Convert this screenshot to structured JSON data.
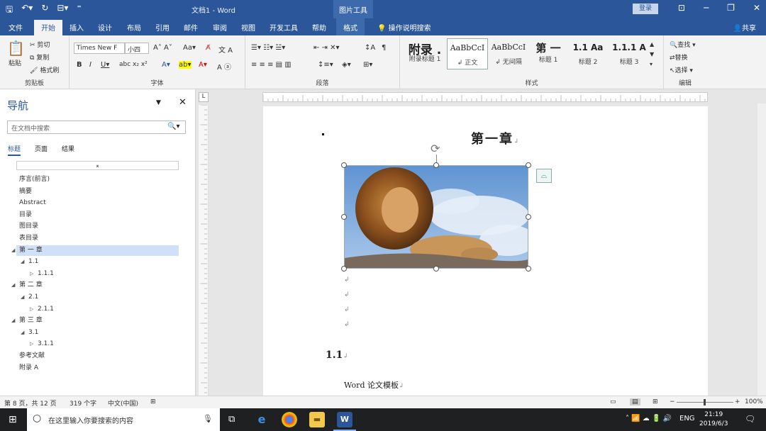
{
  "titlebar": {
    "title": "文档1 - Word",
    "context_tab": "图片工具",
    "login": "登录"
  },
  "tabs": [
    "文件",
    "开始",
    "插入",
    "设计",
    "布局",
    "引用",
    "邮件",
    "审阅",
    "视图",
    "开发工具",
    "帮助",
    "格式"
  ],
  "tell_me": "操作说明搜索",
  "share": "共享",
  "ribbon": {
    "clipboard": {
      "paste": "粘贴",
      "cut": "剪切",
      "copy": "复制",
      "format_painter": "格式刷",
      "label": "剪贴板"
    },
    "font": {
      "name": "Times New F",
      "size": "小四",
      "label": "字体"
    },
    "paragraph": {
      "label": "段落"
    },
    "styles": {
      "label": "样式",
      "items": [
        {
          "preview": "附录 .",
          "name": "附录标题 1"
        },
        {
          "preview": "AaBbCcI",
          "name": "↲ 正文"
        },
        {
          "preview": "AaBbCcI",
          "name": "↲ 无间隔"
        },
        {
          "preview": "第 一",
          "name": "标题 1"
        },
        {
          "preview": "1.1 Aa",
          "name": "标题 2"
        },
        {
          "preview": "1.1.1 A",
          "name": "标题 3"
        }
      ]
    },
    "editing": {
      "find": "查找",
      "replace": "替换",
      "select": "选择",
      "label": "编辑"
    }
  },
  "nav": {
    "title": "导航",
    "search_placeholder": "在文档中搜索",
    "tabs": [
      "标题",
      "页面",
      "结果"
    ],
    "items": [
      {
        "label": "序言(前言)",
        "level": 0,
        "expand": ""
      },
      {
        "label": "摘要",
        "level": 0,
        "expand": ""
      },
      {
        "label": "Abstract",
        "level": 0,
        "expand": ""
      },
      {
        "label": "目录",
        "level": 0,
        "expand": ""
      },
      {
        "label": "图目录",
        "level": 0,
        "expand": ""
      },
      {
        "label": "表目录",
        "level": 0,
        "expand": ""
      },
      {
        "label": "第 一 章",
        "level": 0,
        "expand": "open",
        "selected": true
      },
      {
        "label": "1.1",
        "level": 1,
        "expand": "open"
      },
      {
        "label": "1.1.1",
        "level": 2,
        "expand": "closed"
      },
      {
        "label": "第 二 章",
        "level": 0,
        "expand": "open"
      },
      {
        "label": "2.1",
        "level": 1,
        "expand": "open"
      },
      {
        "label": "2.1.1",
        "level": 2,
        "expand": "closed"
      },
      {
        "label": "第 三 章",
        "level": 0,
        "expand": "open"
      },
      {
        "label": "3.1",
        "level": 1,
        "expand": "open"
      },
      {
        "label": "3.1.1",
        "level": 2,
        "expand": "closed"
      },
      {
        "label": "参考文献",
        "level": 0,
        "expand": ""
      },
      {
        "label": "附录 A",
        "level": 0,
        "expand": ""
      }
    ]
  },
  "document": {
    "chapter_title": "第一章",
    "heading": "1.1",
    "body_text": "Word 论文模板"
  },
  "status": {
    "page": "第 8 页，共 12 页",
    "words": "319 个字",
    "language": "中文(中国)",
    "zoom": "100%"
  },
  "taskbar": {
    "search_placeholder": "在这里输入你要搜索的内容",
    "lang": "ENG",
    "time": "21:19",
    "date": "2019/6/3"
  }
}
